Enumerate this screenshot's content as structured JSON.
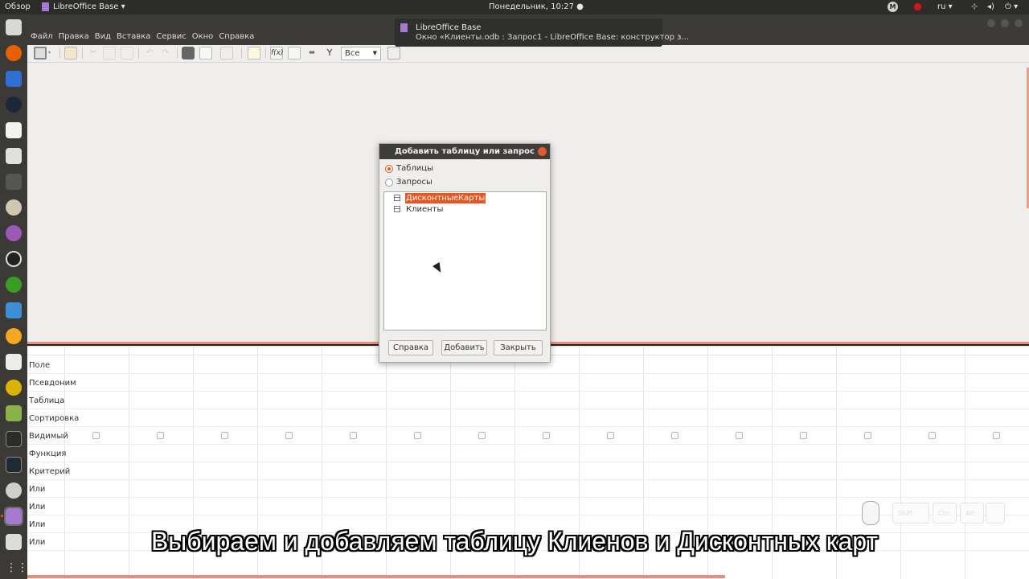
{
  "topbar": {
    "overview": "Обзор",
    "app_name": "LibreOffice Base",
    "clock": "Понедельник, 10:27 ●",
    "lang": "ru ▾",
    "m_badge": "M",
    "tray_icons": [
      "network-icon",
      "volume-icon",
      "power-icon"
    ]
  },
  "menu": [
    "Файл",
    "Правка",
    "Вид",
    "Вставка",
    "Сервис",
    "Окно",
    "Справка"
  ],
  "toolbar": {
    "filter_value": "Все"
  },
  "notification": {
    "title": "LibreOffice Base",
    "body": "Окно «Клиенты.odb : Запрос1 - LibreOffice Base: конструктор з..."
  },
  "dialog": {
    "title": "Добавить таблицу или запрос",
    "radio_tables": "Таблицы",
    "radio_queries": "Запросы",
    "selected_radio": "tables",
    "items": [
      "ДисконтныеКарты",
      "Клиенты"
    ],
    "selected_item": 0,
    "buttons": {
      "help": "Справка",
      "add": "Добавить",
      "close": "Закрыть"
    }
  },
  "grid": {
    "rows": [
      "Поле",
      "Псевдоним",
      "Таблица",
      "Сортировка",
      "Видимый",
      "Функция",
      "Критерий",
      "Или",
      "Или",
      "Или",
      "Или"
    ],
    "visible_row_index": 4,
    "column_count": 15
  },
  "keyviz": {
    "keys": [
      "Shift",
      "Ctrl",
      "Alt"
    ]
  },
  "subtitle": "Выбираем и добавляем таблицу Клиенов и Дисконтных карт",
  "colors": {
    "accent": "#e95420",
    "splitter": "#e8907a",
    "dock": "#3b3a36",
    "titlebar": "#3c3b37"
  }
}
